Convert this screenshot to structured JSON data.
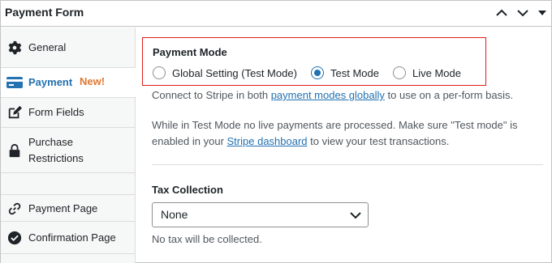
{
  "header": {
    "title": "Payment Form"
  },
  "sidebar": {
    "items": [
      {
        "label": "General",
        "icon": "gear-icon"
      },
      {
        "label": "Payment",
        "badge": "New!",
        "icon": "credit-card-icon"
      },
      {
        "label": "Form Fields",
        "icon": "edit-icon"
      },
      {
        "label_line1": "Purchase",
        "label_line2": "Restrictions",
        "icon": "lock-icon"
      },
      {
        "label": "Payment Page",
        "icon": "link-icon"
      },
      {
        "label": "Confirmation Page",
        "icon": "check-circle-icon"
      }
    ]
  },
  "payment_mode": {
    "title": "Payment Mode",
    "options": [
      {
        "label": "Global Setting (Test Mode)",
        "checked": false
      },
      {
        "label": "Test Mode",
        "checked": true
      },
      {
        "label": "Live Mode",
        "checked": false
      }
    ]
  },
  "connect_text": {
    "before": "Connect to Stripe in both ",
    "link": "payment modes globally",
    "after": " to use on a per-form basis."
  },
  "test_mode_text": {
    "line1": "While in Test Mode no live payments are processed. Make sure \"Test mode\" is",
    "before": "enabled in your ",
    "link": "Stripe dashboard",
    "after": " to view your test transactions."
  },
  "tax": {
    "label": "Tax Collection",
    "selected": "None",
    "help": "No tax will be collected."
  },
  "colors": {
    "accent": "#2271b1",
    "badge": "#e27730",
    "highlight_border": "#e01e1e"
  }
}
